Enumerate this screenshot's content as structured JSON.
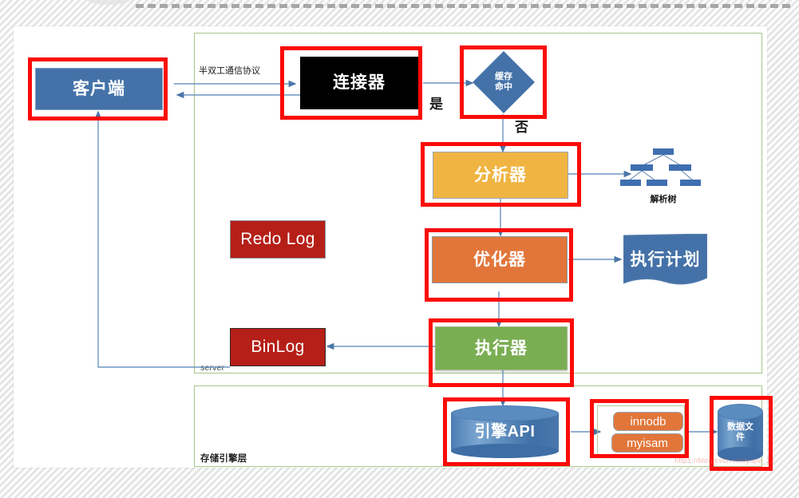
{
  "slide": {
    "layers": [
      {
        "id": "server",
        "label": "server"
      },
      {
        "id": "storage",
        "label": "存储引擎层"
      }
    ],
    "nodes": {
      "client": "客户端",
      "connector": "连接器",
      "cache_decision": "缓存\n命中",
      "cache_decision_line1": "缓存",
      "cache_decision_line2": "命中",
      "parser": "分析器",
      "optimizer": "优化器",
      "executor": "执行器",
      "redo_log": "Redo Log",
      "bin_log": "BinLog",
      "engine_api": "引擎API",
      "exec_plan": "执行计划",
      "parse_tree_caption": "解析树",
      "innodb": "innodb",
      "myisam": "myisam",
      "data_file_line1": "数据文",
      "data_file_line2": "件"
    },
    "annotations": {
      "protocol": "半双工通信协议",
      "yes": "是",
      "no": "否"
    },
    "watermark": "https://blog.csdn.net/yajie_12",
    "colors": {
      "client_blue": "#4472a8",
      "connector_black": "#000000",
      "parser_yellow": "#f0b442",
      "optimizer_orange": "#e2763a",
      "executor_green": "#7aae52",
      "log_red": "#b51f18",
      "highlight_red": "#fb0b08",
      "layer_green": "#a8c48a",
      "arrow_blue": "#4a76a8"
    }
  }
}
